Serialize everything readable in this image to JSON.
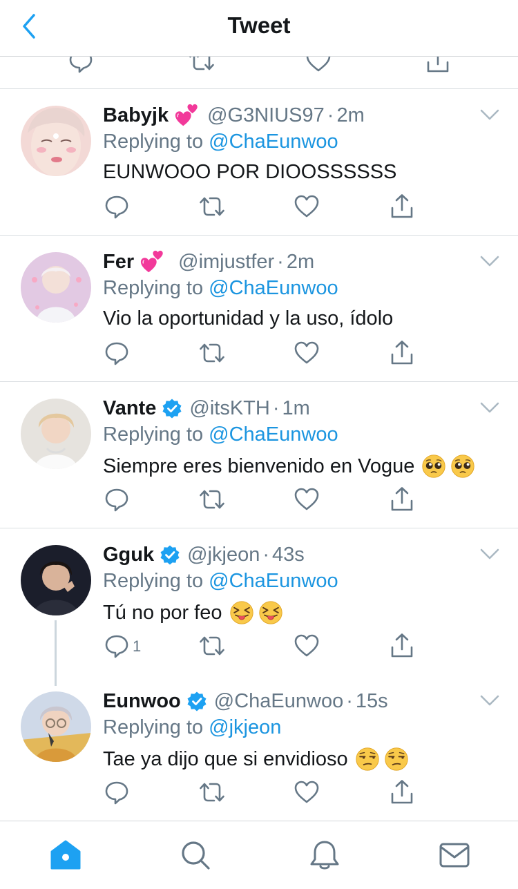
{
  "header": {
    "title": "Tweet",
    "back_icon": "chevron-left-icon"
  },
  "colors": {
    "accent": "#1da1f2",
    "link": "#1b95e0",
    "secondary_text": "#657786",
    "divider": "#d9dde1"
  },
  "tweets": [
    {
      "name": "Babyjk",
      "name_emoji": "two-hearts-emoji",
      "handle": "@G3NIUS97",
      "dot": "·",
      "time": "2m",
      "reply_prefix": "Replying to",
      "reply_to": "@ChaEunwoo",
      "text": "EUNWOOO POR DIOOSSSSSS"
    },
    {
      "name": "Fer",
      "name_emoji": "two-hearts-emoji",
      "handle": "@imjustfer",
      "dot": "·",
      "time": "2m",
      "reply_prefix": "Replying to",
      "reply_to": "@ChaEunwoo",
      "text": "Vio la oportunidad y la uso, ídolo"
    },
    {
      "name": "Vante",
      "verified": true,
      "handle": "@itsKTH",
      "dot": "·",
      "time": "1m",
      "reply_prefix": "Replying to",
      "reply_to": "@ChaEunwoo",
      "text": "Siempre eres bienvenido en Vogue",
      "text_emoji": "pleading-face-emoji"
    },
    {
      "name": "Gguk",
      "verified": true,
      "handle": "@jkjeon",
      "dot": "·",
      "time": "43s",
      "reply_prefix": "Replying to",
      "reply_to": "@ChaEunwoo",
      "text": "Tú no por feo",
      "text_emoji": "squinting-tongue-emoji",
      "reply_count": "1"
    },
    {
      "name": "Eunwoo",
      "verified": true,
      "handle": "@ChaEunwoo",
      "dot": "·",
      "time": "15s",
      "reply_prefix": "Replying to",
      "reply_to": "@jkjeon",
      "text": "Tae ya dijo que si envidioso",
      "text_emoji": "unamused-face-emoji"
    }
  ],
  "tabbar": {
    "items": [
      "home-icon",
      "search-icon",
      "notifications-icon",
      "messages-icon"
    ],
    "active": "home-icon"
  }
}
